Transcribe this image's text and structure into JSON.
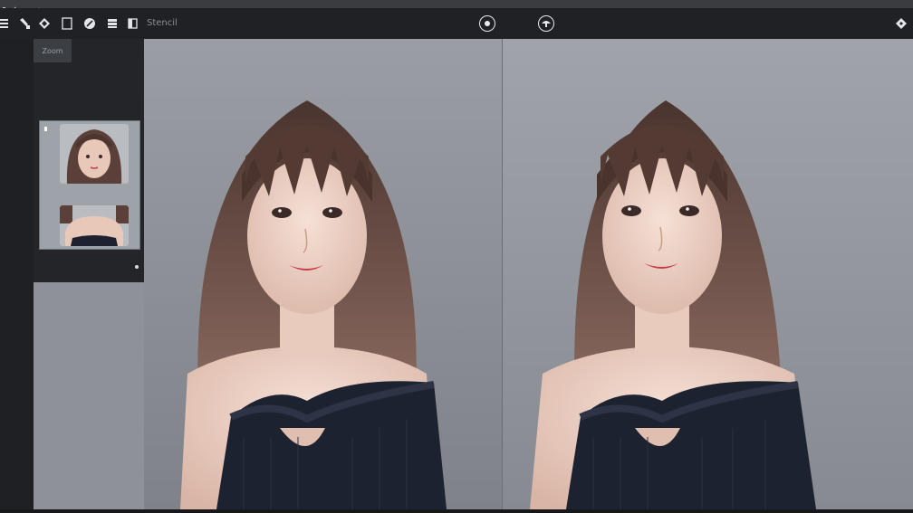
{
  "toolbar": {
    "zoom_label": "Stencil",
    "left_tools": [
      "menu-icon",
      "brush-icon",
      "pen-icon",
      "rectangle-icon",
      "eraser-icon",
      "layers-icon",
      "panel-icon"
    ],
    "center_tools": [
      "circle-target-icon",
      "mushroom-icon"
    ],
    "right_tools": [
      "pin-icon"
    ]
  },
  "side_panel": {
    "tab_label": "Zoom"
  },
  "colors": {
    "toolbar_bg": "#1f2124",
    "panel_bg": "#232528",
    "canvas_left": "#8e9298",
    "canvas_right": "#969aa0",
    "accent_red": "#e04040"
  }
}
